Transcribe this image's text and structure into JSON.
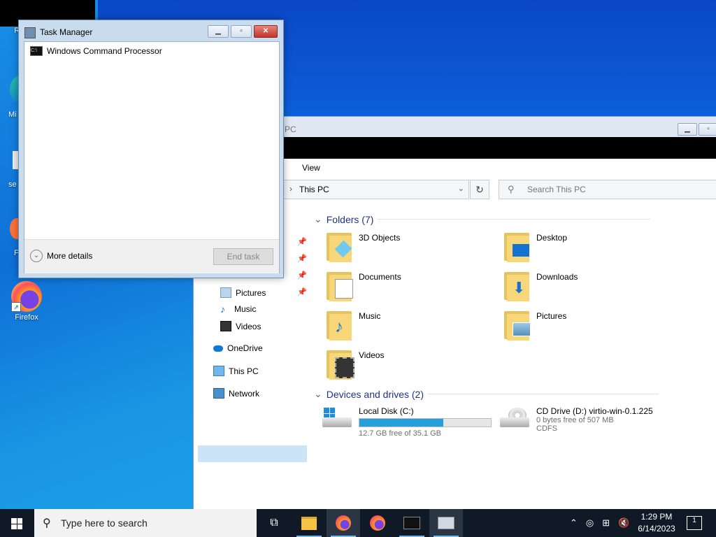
{
  "desktop": {
    "icons": [
      {
        "label": "Rec"
      },
      {
        "label": "Mi"
      },
      {
        "label": "se"
      },
      {
        "label": "F"
      },
      {
        "label": "Firefox"
      }
    ]
  },
  "task_manager": {
    "title": "Task Manager",
    "processes": [
      {
        "name": "Windows Command Processor"
      }
    ],
    "more_details": "More details",
    "end_task": "End task"
  },
  "explorer": {
    "title_fragment": "PC",
    "ribbon_tab": "View",
    "address": "This PC",
    "search_placeholder": "Search This PC",
    "nav": [
      {
        "label": "Pictures"
      },
      {
        "label": "Music"
      },
      {
        "label": "Videos"
      },
      {
        "label": "OneDrive"
      },
      {
        "label": "This PC"
      },
      {
        "label": "Network"
      }
    ],
    "folders_header": "Folders (7)",
    "folders": [
      {
        "name": "3D Objects"
      },
      {
        "name": "Desktop"
      },
      {
        "name": "Documents"
      },
      {
        "name": "Downloads"
      },
      {
        "name": "Music"
      },
      {
        "name": "Pictures"
      },
      {
        "name": "Videos"
      }
    ],
    "drives_header": "Devices and drives (2)",
    "drives": [
      {
        "name": "Local Disk (C:)",
        "free": "12.7 GB free of 35.1 GB",
        "used_fraction": 0.64
      },
      {
        "name": "CD Drive (D:) virtio-win-0.1.225",
        "free": "0 bytes free of 507 MB",
        "fs": "CDFS"
      }
    ]
  },
  "taskbar": {
    "search_placeholder": "Type here to search",
    "time": "1:29 PM",
    "date": "6/14/2023",
    "notifications": "1"
  }
}
